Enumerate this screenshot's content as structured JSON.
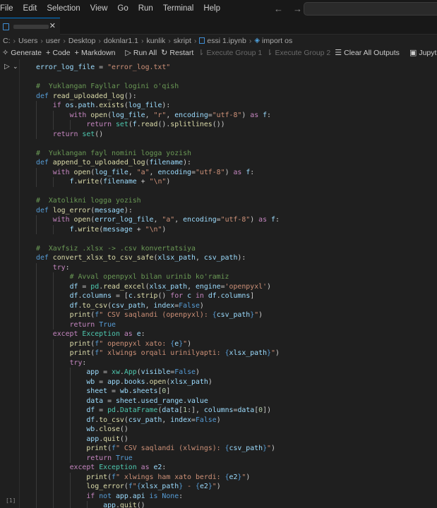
{
  "menu": [
    "File",
    "Edit",
    "Selection",
    "View",
    "Go",
    "Run",
    "Terminal",
    "Help"
  ],
  "nav": {
    "back": "←",
    "forward": "→"
  },
  "tab": {
    "close": "✕"
  },
  "breadcrumb": [
    "C:",
    "Users",
    "user",
    "Desktop",
    "doknlar1.1",
    "kunlik",
    "skript",
    "essi 1.ipynb",
    "import os"
  ],
  "toolbar": {
    "generate": "Generate",
    "code": "Code",
    "markdown": "Markdown",
    "run_all": "Run All",
    "restart": "Restart",
    "execute_group_1": "Execute Group 1",
    "execute_group_2": "Execute Group 2",
    "clear_all_outputs": "Clear All Outputs",
    "jupyter": "Jupyter"
  },
  "cell": {
    "execution_count": "[1]"
  },
  "code_lines": [
    {
      "indent": 0,
      "tokens": [
        [
          "var",
          "error_log_file"
        ],
        [
          "pl",
          " = "
        ],
        [
          "str",
          "\"error_log.txt\""
        ]
      ]
    },
    {
      "indent": 0,
      "tokens": []
    },
    {
      "indent": 0,
      "tokens": [
        [
          "cm",
          "#  Yuklangan Fayllar logini o'qish"
        ]
      ]
    },
    {
      "indent": 0,
      "tokens": [
        [
          "kw",
          "def "
        ],
        [
          "fn",
          "read_uploaded_log"
        ],
        [
          "pl",
          "():"
        ]
      ]
    },
    {
      "indent": 1,
      "tokens": [
        [
          "ct",
          "if "
        ],
        [
          "var",
          "os"
        ],
        [
          "pl",
          "."
        ],
        [
          "var",
          "path"
        ],
        [
          "pl",
          "."
        ],
        [
          "fn",
          "exists"
        ],
        [
          "pl",
          "("
        ],
        [
          "var",
          "log_file"
        ],
        [
          "pl",
          "):"
        ]
      ]
    },
    {
      "indent": 2,
      "tokens": [
        [
          "ct",
          "with "
        ],
        [
          "fn",
          "open"
        ],
        [
          "pl",
          "("
        ],
        [
          "var",
          "log_file"
        ],
        [
          "pl",
          ", "
        ],
        [
          "str",
          "\"r\""
        ],
        [
          "pl",
          ", "
        ],
        [
          "var",
          "encoding"
        ],
        [
          "pl",
          "="
        ],
        [
          "str",
          "\"utf-8\""
        ],
        [
          "pl",
          ") "
        ],
        [
          "ct",
          "as "
        ],
        [
          "var",
          "f"
        ],
        [
          "pl",
          ":"
        ]
      ]
    },
    {
      "indent": 3,
      "tokens": [
        [
          "ct",
          "return "
        ],
        [
          "cls",
          "set"
        ],
        [
          "pl",
          "("
        ],
        [
          "var",
          "f"
        ],
        [
          "pl",
          "."
        ],
        [
          "fn",
          "read"
        ],
        [
          "pl",
          "()."
        ],
        [
          "fn",
          "splitlines"
        ],
        [
          "pl",
          "())"
        ]
      ]
    },
    {
      "indent": 1,
      "tokens": [
        [
          "ct",
          "return "
        ],
        [
          "cls",
          "set"
        ],
        [
          "pl",
          "()"
        ]
      ]
    },
    {
      "indent": 0,
      "tokens": []
    },
    {
      "indent": 0,
      "tokens": [
        [
          "cm",
          "#  Yuklangan fayl nomini logga yozish"
        ]
      ]
    },
    {
      "indent": 0,
      "tokens": [
        [
          "kw",
          "def "
        ],
        [
          "fn",
          "append_to_uploaded_log"
        ],
        [
          "pl",
          "("
        ],
        [
          "var",
          "filename"
        ],
        [
          "pl",
          "):"
        ]
      ]
    },
    {
      "indent": 1,
      "tokens": [
        [
          "ct",
          "with "
        ],
        [
          "fn",
          "open"
        ],
        [
          "pl",
          "("
        ],
        [
          "var",
          "log_file"
        ],
        [
          "pl",
          ", "
        ],
        [
          "str",
          "\"a\""
        ],
        [
          "pl",
          ", "
        ],
        [
          "var",
          "encoding"
        ],
        [
          "pl",
          "="
        ],
        [
          "str",
          "\"utf-8\""
        ],
        [
          "pl",
          ") "
        ],
        [
          "ct",
          "as "
        ],
        [
          "var",
          "f"
        ],
        [
          "pl",
          ":"
        ]
      ]
    },
    {
      "indent": 2,
      "tokens": [
        [
          "var",
          "f"
        ],
        [
          "pl",
          "."
        ],
        [
          "fn",
          "write"
        ],
        [
          "pl",
          "("
        ],
        [
          "var",
          "filename"
        ],
        [
          "pl",
          " + "
        ],
        [
          "str",
          "\"\\n\""
        ],
        [
          "pl",
          ")"
        ]
      ]
    },
    {
      "indent": 0,
      "tokens": []
    },
    {
      "indent": 0,
      "tokens": [
        [
          "cm",
          "#  Xatolikni logga yozish"
        ]
      ]
    },
    {
      "indent": 0,
      "tokens": [
        [
          "kw",
          "def "
        ],
        [
          "fn",
          "log_error"
        ],
        [
          "pl",
          "("
        ],
        [
          "var",
          "message"
        ],
        [
          "pl",
          "):"
        ]
      ]
    },
    {
      "indent": 1,
      "tokens": [
        [
          "ct",
          "with "
        ],
        [
          "fn",
          "open"
        ],
        [
          "pl",
          "("
        ],
        [
          "var",
          "error_log_file"
        ],
        [
          "pl",
          ", "
        ],
        [
          "str",
          "\"a\""
        ],
        [
          "pl",
          ", "
        ],
        [
          "var",
          "encoding"
        ],
        [
          "pl",
          "="
        ],
        [
          "str",
          "\"utf-8\""
        ],
        [
          "pl",
          ") "
        ],
        [
          "ct",
          "as "
        ],
        [
          "var",
          "f"
        ],
        [
          "pl",
          ":"
        ]
      ]
    },
    {
      "indent": 2,
      "tokens": [
        [
          "var",
          "f"
        ],
        [
          "pl",
          "."
        ],
        [
          "fn",
          "write"
        ],
        [
          "pl",
          "("
        ],
        [
          "var",
          "message"
        ],
        [
          "pl",
          " + "
        ],
        [
          "str",
          "\"\\n\""
        ],
        [
          "pl",
          ")"
        ]
      ]
    },
    {
      "indent": 0,
      "tokens": []
    },
    {
      "indent": 0,
      "tokens": [
        [
          "cm",
          "#  Xavfsiz .xlsx -> .csv konvertatsiya"
        ]
      ]
    },
    {
      "indent": 0,
      "tokens": [
        [
          "kw",
          "def "
        ],
        [
          "fn",
          "convert_xlsx_to_csv_safe"
        ],
        [
          "pl",
          "("
        ],
        [
          "var",
          "xlsx_path"
        ],
        [
          "pl",
          ", "
        ],
        [
          "var",
          "csv_path"
        ],
        [
          "pl",
          "):"
        ]
      ]
    },
    {
      "indent": 1,
      "tokens": [
        [
          "ct",
          "try"
        ],
        [
          "pl",
          ":"
        ]
      ]
    },
    {
      "indent": 2,
      "tokens": [
        [
          "cm",
          "# Avval openpyxl bilan urinib ko'ramiz"
        ]
      ]
    },
    {
      "indent": 2,
      "tokens": [
        [
          "var",
          "df"
        ],
        [
          "pl",
          " = "
        ],
        [
          "cls",
          "pd"
        ],
        [
          "pl",
          "."
        ],
        [
          "fn",
          "read_excel"
        ],
        [
          "pl",
          "("
        ],
        [
          "var",
          "xlsx_path"
        ],
        [
          "pl",
          ", "
        ],
        [
          "var",
          "engine"
        ],
        [
          "pl",
          "="
        ],
        [
          "str",
          "'openpyxl'"
        ],
        [
          "pl",
          ")"
        ]
      ]
    },
    {
      "indent": 2,
      "tokens": [
        [
          "var",
          "df"
        ],
        [
          "pl",
          "."
        ],
        [
          "var",
          "columns"
        ],
        [
          "pl",
          " = ["
        ],
        [
          "var",
          "c"
        ],
        [
          "pl",
          "."
        ],
        [
          "fn",
          "strip"
        ],
        [
          "pl",
          "() "
        ],
        [
          "ct",
          "for "
        ],
        [
          "var",
          "c"
        ],
        [
          "ct",
          " in "
        ],
        [
          "var",
          "df"
        ],
        [
          "pl",
          "."
        ],
        [
          "var",
          "columns"
        ],
        [
          "pl",
          "]"
        ]
      ]
    },
    {
      "indent": 2,
      "tokens": [
        [
          "var",
          "df"
        ],
        [
          "pl",
          "."
        ],
        [
          "fn",
          "to_csv"
        ],
        [
          "pl",
          "("
        ],
        [
          "var",
          "csv_path"
        ],
        [
          "pl",
          ", "
        ],
        [
          "var",
          "index"
        ],
        [
          "pl",
          "="
        ],
        [
          "kw",
          "False"
        ],
        [
          "pl",
          ")"
        ]
      ]
    },
    {
      "indent": 2,
      "tokens": [
        [
          "fn",
          "print"
        ],
        [
          "pl",
          "("
        ],
        [
          "kw",
          "f"
        ],
        [
          "str",
          "\" CSV saqlandi (openpyxl): "
        ],
        [
          "kw",
          "{"
        ],
        [
          "var",
          "csv_path"
        ],
        [
          "kw",
          "}"
        ],
        [
          "str",
          "\""
        ],
        [
          "pl",
          ")"
        ]
      ]
    },
    {
      "indent": 2,
      "tokens": [
        [
          "ct",
          "return "
        ],
        [
          "kw",
          "True"
        ]
      ]
    },
    {
      "indent": 1,
      "tokens": [
        [
          "ct",
          "except "
        ],
        [
          "cls",
          "Exception"
        ],
        [
          "ct",
          " as "
        ],
        [
          "var",
          "e"
        ],
        [
          "pl",
          ":"
        ]
      ]
    },
    {
      "indent": 2,
      "tokens": [
        [
          "fn",
          "print"
        ],
        [
          "pl",
          "("
        ],
        [
          "kw",
          "f"
        ],
        [
          "str",
          "\" openpyxl xato: "
        ],
        [
          "kw",
          "{"
        ],
        [
          "var",
          "e"
        ],
        [
          "kw",
          "}"
        ],
        [
          "str",
          "\""
        ],
        [
          "pl",
          ")"
        ]
      ]
    },
    {
      "indent": 2,
      "tokens": [
        [
          "fn",
          "print"
        ],
        [
          "pl",
          "("
        ],
        [
          "kw",
          "f"
        ],
        [
          "str",
          "\" xlwings orqali urinilyapti: "
        ],
        [
          "kw",
          "{"
        ],
        [
          "var",
          "xlsx_path"
        ],
        [
          "kw",
          "}"
        ],
        [
          "str",
          "\""
        ],
        [
          "pl",
          ")"
        ]
      ]
    },
    {
      "indent": 2,
      "tokens": [
        [
          "ct",
          "try"
        ],
        [
          "pl",
          ":"
        ]
      ]
    },
    {
      "indent": 3,
      "tokens": [
        [
          "var",
          "app"
        ],
        [
          "pl",
          " = "
        ],
        [
          "cls",
          "xw"
        ],
        [
          "pl",
          "."
        ],
        [
          "cls",
          "App"
        ],
        [
          "pl",
          "("
        ],
        [
          "var",
          "visible"
        ],
        [
          "pl",
          "="
        ],
        [
          "kw",
          "False"
        ],
        [
          "pl",
          ")"
        ]
      ]
    },
    {
      "indent": 3,
      "tokens": [
        [
          "var",
          "wb"
        ],
        [
          "pl",
          " = "
        ],
        [
          "var",
          "app"
        ],
        [
          "pl",
          "."
        ],
        [
          "var",
          "books"
        ],
        [
          "pl",
          "."
        ],
        [
          "fn",
          "open"
        ],
        [
          "pl",
          "("
        ],
        [
          "var",
          "xlsx_path"
        ],
        [
          "pl",
          ")"
        ]
      ]
    },
    {
      "indent": 3,
      "tokens": [
        [
          "var",
          "sheet"
        ],
        [
          "pl",
          " = "
        ],
        [
          "var",
          "wb"
        ],
        [
          "pl",
          "."
        ],
        [
          "var",
          "sheets"
        ],
        [
          "pl",
          "["
        ],
        [
          "num",
          "0"
        ],
        [
          "pl",
          "]"
        ]
      ]
    },
    {
      "indent": 3,
      "tokens": [
        [
          "var",
          "data"
        ],
        [
          "pl",
          " = "
        ],
        [
          "var",
          "sheet"
        ],
        [
          "pl",
          "."
        ],
        [
          "var",
          "used_range"
        ],
        [
          "pl",
          "."
        ],
        [
          "var",
          "value"
        ]
      ]
    },
    {
      "indent": 3,
      "tokens": [
        [
          "var",
          "df"
        ],
        [
          "pl",
          " = "
        ],
        [
          "cls",
          "pd"
        ],
        [
          "pl",
          "."
        ],
        [
          "cls",
          "DataFrame"
        ],
        [
          "pl",
          "("
        ],
        [
          "var",
          "data"
        ],
        [
          "pl",
          "["
        ],
        [
          "num",
          "1"
        ],
        [
          "pl",
          ":], "
        ],
        [
          "var",
          "columns"
        ],
        [
          "pl",
          "="
        ],
        [
          "var",
          "data"
        ],
        [
          "pl",
          "["
        ],
        [
          "num",
          "0"
        ],
        [
          "pl",
          "])"
        ]
      ]
    },
    {
      "indent": 3,
      "tokens": [
        [
          "var",
          "df"
        ],
        [
          "pl",
          "."
        ],
        [
          "fn",
          "to_csv"
        ],
        [
          "pl",
          "("
        ],
        [
          "var",
          "csv_path"
        ],
        [
          "pl",
          ", "
        ],
        [
          "var",
          "index"
        ],
        [
          "pl",
          "="
        ],
        [
          "kw",
          "False"
        ],
        [
          "pl",
          ")"
        ]
      ]
    },
    {
      "indent": 3,
      "tokens": [
        [
          "var",
          "wb"
        ],
        [
          "pl",
          "."
        ],
        [
          "fn",
          "close"
        ],
        [
          "pl",
          "()"
        ]
      ]
    },
    {
      "indent": 3,
      "tokens": [
        [
          "var",
          "app"
        ],
        [
          "pl",
          "."
        ],
        [
          "fn",
          "quit"
        ],
        [
          "pl",
          "()"
        ]
      ]
    },
    {
      "indent": 3,
      "tokens": [
        [
          "fn",
          "print"
        ],
        [
          "pl",
          "("
        ],
        [
          "kw",
          "f"
        ],
        [
          "str",
          "\" CSV saqlandi (xlwings): "
        ],
        [
          "kw",
          "{"
        ],
        [
          "var",
          "csv_path"
        ],
        [
          "kw",
          "}"
        ],
        [
          "str",
          "\""
        ],
        [
          "pl",
          ")"
        ]
      ]
    },
    {
      "indent": 3,
      "tokens": [
        [
          "ct",
          "return "
        ],
        [
          "kw",
          "True"
        ]
      ]
    },
    {
      "indent": 2,
      "tokens": [
        [
          "ct",
          "except "
        ],
        [
          "cls",
          "Exception"
        ],
        [
          "ct",
          " as "
        ],
        [
          "var",
          "e2"
        ],
        [
          "pl",
          ":"
        ]
      ]
    },
    {
      "indent": 3,
      "tokens": [
        [
          "fn",
          "print"
        ],
        [
          "pl",
          "("
        ],
        [
          "kw",
          "f"
        ],
        [
          "str",
          "\" xlwings ham xato berdi: "
        ],
        [
          "kw",
          "{"
        ],
        [
          "var",
          "e2"
        ],
        [
          "kw",
          "}"
        ],
        [
          "str",
          "\""
        ],
        [
          "pl",
          ")"
        ]
      ]
    },
    {
      "indent": 3,
      "tokens": [
        [
          "fn",
          "log_error"
        ],
        [
          "pl",
          "("
        ],
        [
          "kw",
          "f"
        ],
        [
          "str",
          "\""
        ],
        [
          "kw",
          "{"
        ],
        [
          "var",
          "xlsx_path"
        ],
        [
          "kw",
          "}"
        ],
        [
          "str",
          " - "
        ],
        [
          "kw",
          "{"
        ],
        [
          "var",
          "e2"
        ],
        [
          "kw",
          "}"
        ],
        [
          "str",
          "\""
        ],
        [
          "pl",
          ")"
        ]
      ]
    },
    {
      "indent": 3,
      "tokens": [
        [
          "ct",
          "if "
        ],
        [
          "kw",
          "not "
        ],
        [
          "var",
          "app"
        ],
        [
          "pl",
          "."
        ],
        [
          "var",
          "api"
        ],
        [
          "kw",
          " is "
        ],
        [
          "kw",
          "None"
        ],
        [
          "pl",
          ":"
        ]
      ]
    },
    {
      "indent": 4,
      "tokens": [
        [
          "var",
          "app"
        ],
        [
          "pl",
          "."
        ],
        [
          "fn",
          "quit"
        ],
        [
          "pl",
          "()"
        ]
      ]
    }
  ]
}
